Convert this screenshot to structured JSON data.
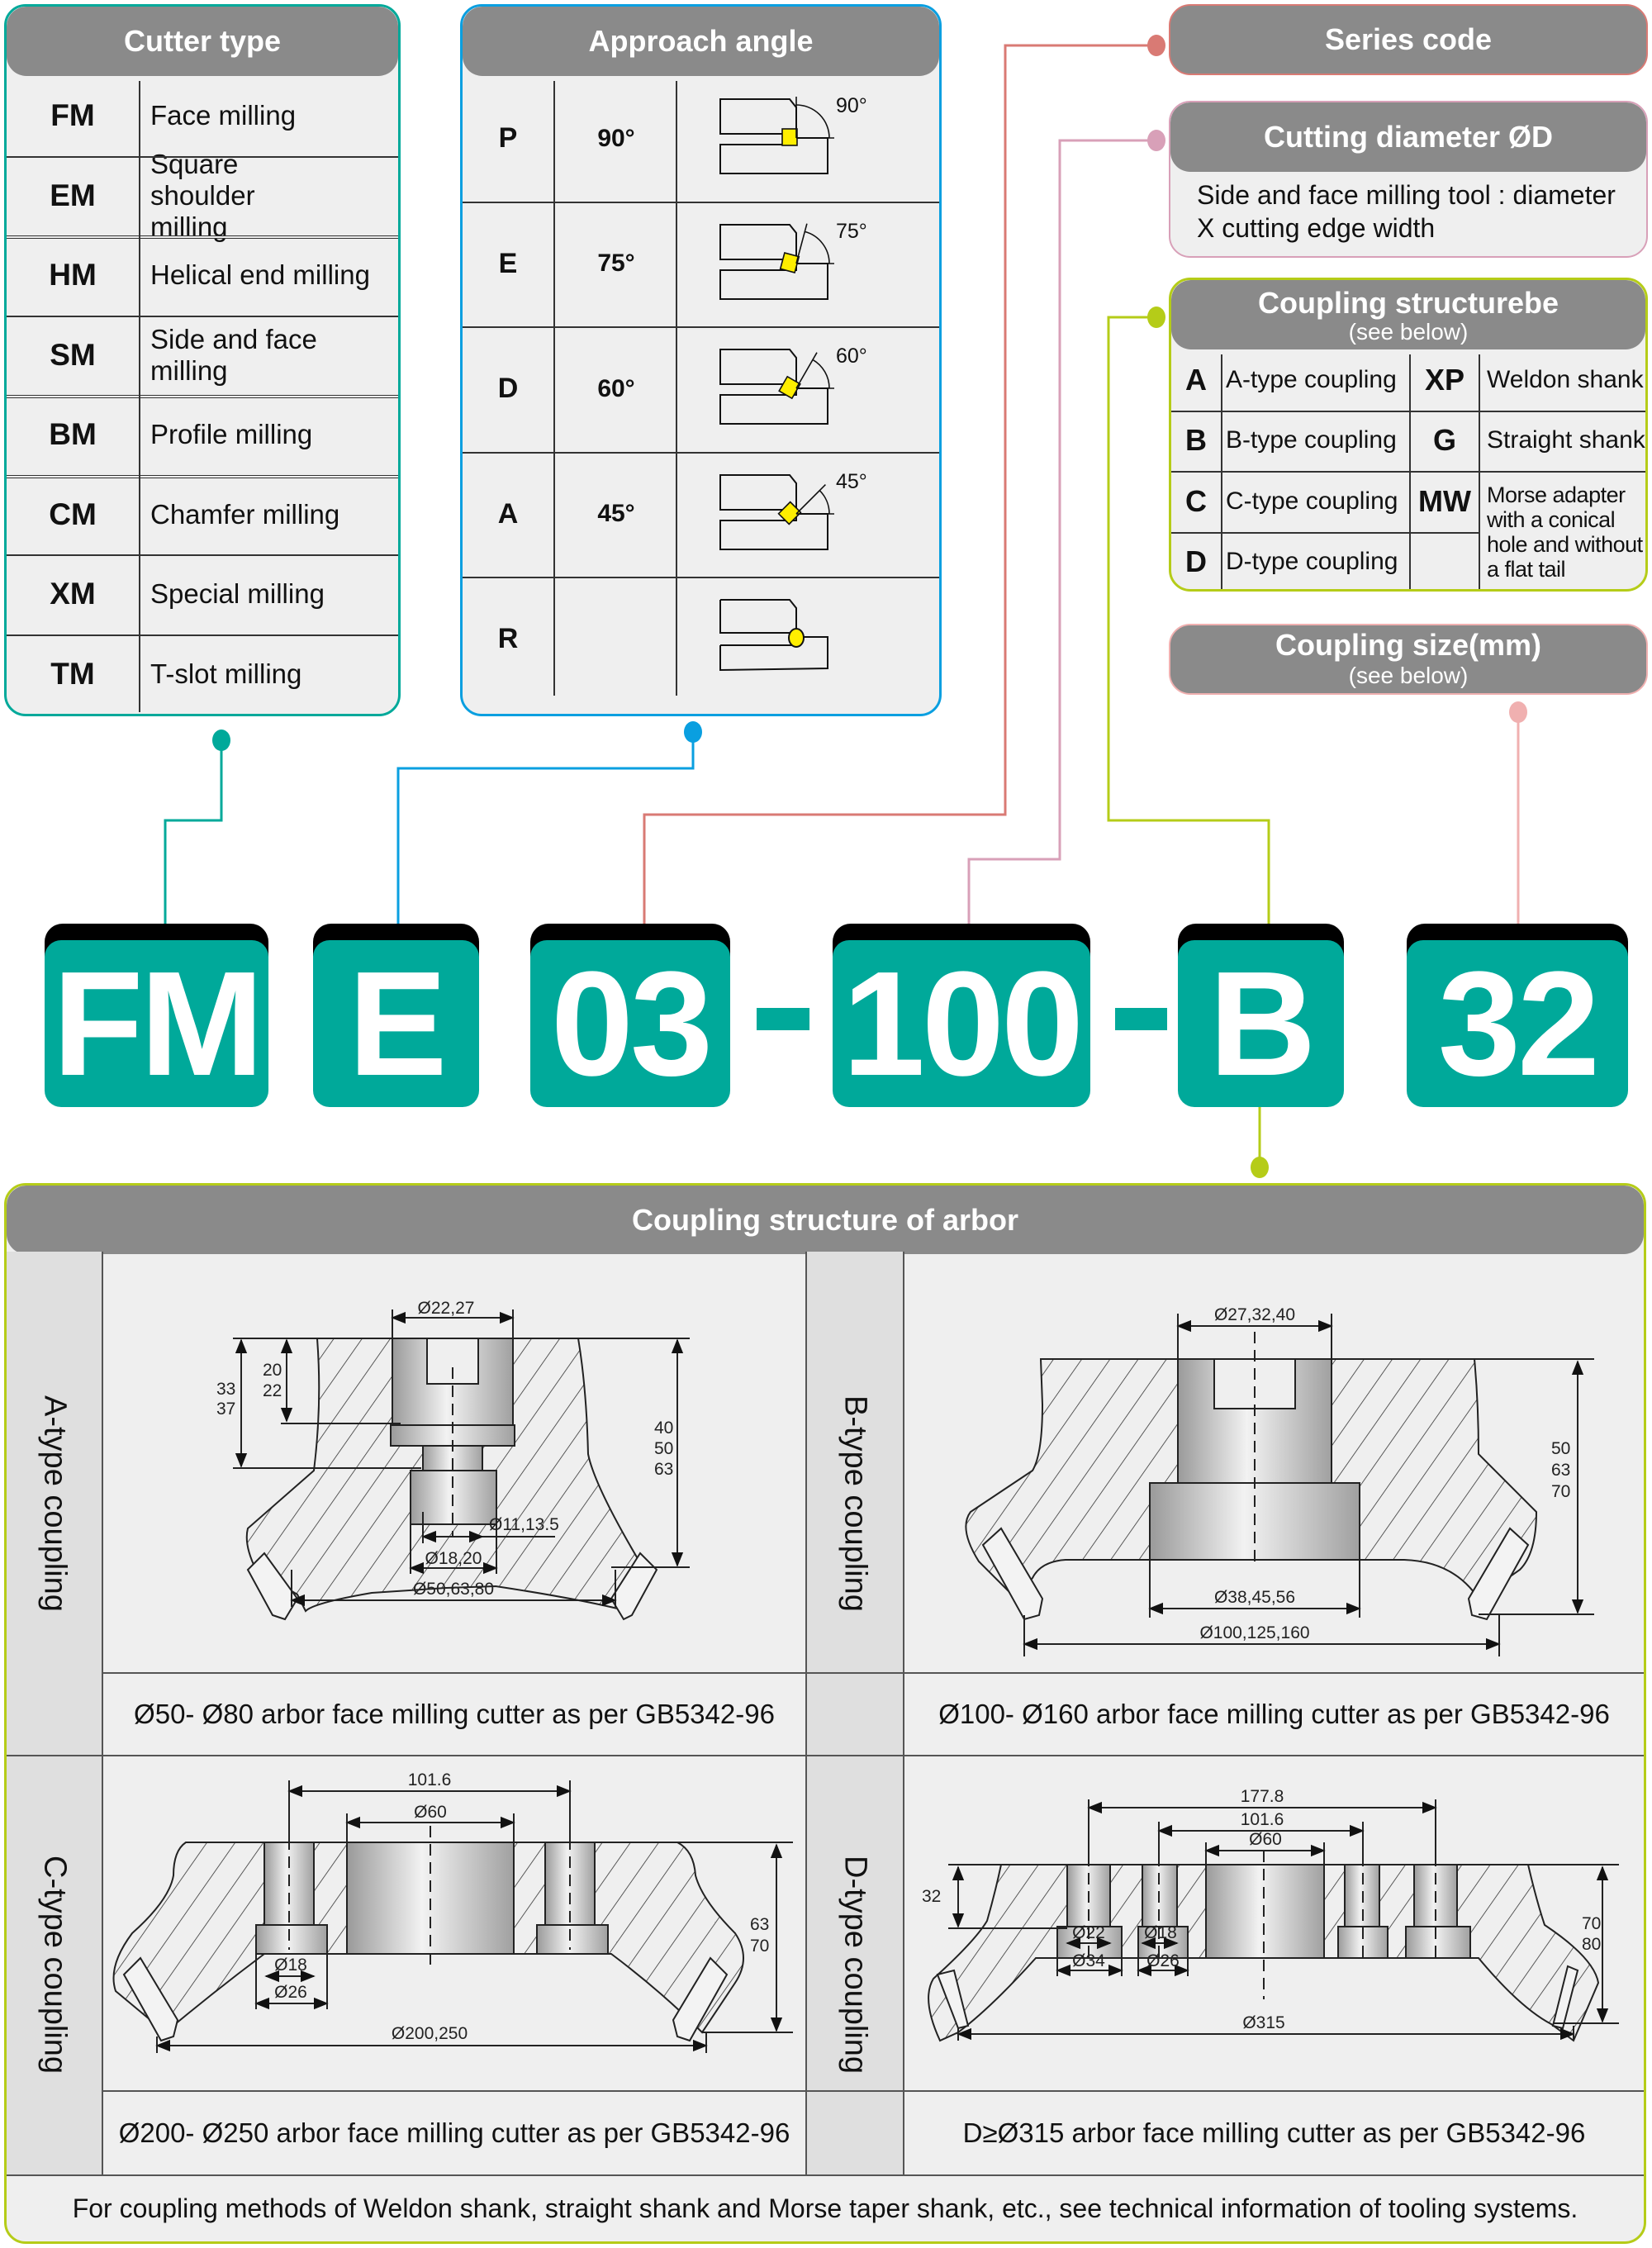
{
  "cutter_type": {
    "title": "Cutter type",
    "rows": [
      {
        "code": "FM",
        "label": "Face milling"
      },
      {
        "code": "EM",
        "label": "Square shoulder milling"
      },
      {
        "code": "HM",
        "label": "Helical end milling"
      },
      {
        "code": "SM",
        "label": "Side and face milling"
      },
      {
        "code": "BM",
        "label": "Profile milling"
      },
      {
        "code": "CM",
        "label": "Chamfer milling"
      },
      {
        "code": "XM",
        "label": "Special milling"
      },
      {
        "code": "TM",
        "label": "T-slot milling"
      }
    ]
  },
  "approach_angle": {
    "title": "Approach angle",
    "rows": [
      {
        "code": "P",
        "angle": "90°",
        "icon_label": "90°",
        "insert": "square"
      },
      {
        "code": "E",
        "angle": "75°",
        "icon_label": "75°",
        "insert": "tilted-square"
      },
      {
        "code": "D",
        "angle": "60°",
        "icon_label": "60°",
        "insert": "tilted-square"
      },
      {
        "code": "A",
        "angle": "45°",
        "icon_label": "45°",
        "insert": "diamond"
      },
      {
        "code": "R",
        "angle": "",
        "icon_label": "",
        "insert": "round"
      }
    ]
  },
  "series_code": {
    "title": "Series code"
  },
  "cutting_diameter": {
    "title": "Cutting diameter ØD",
    "note_line1": "Side and face milling tool : diameter",
    "note_line2": "X cutting edge width"
  },
  "coupling_structure": {
    "title": "Coupling structurebe",
    "subtitle": "(see below)",
    "rows": [
      {
        "code": "A",
        "label": "A-type coupling",
        "code2": "XP",
        "label2": "Weldon shank"
      },
      {
        "code": "B",
        "label": "B-type coupling",
        "code2": "G",
        "label2": "Straight shank"
      },
      {
        "code": "C",
        "label": "C-type coupling",
        "code2": "MW",
        "label2": "Morse adapter with a conical hole and without a flat tail"
      },
      {
        "code": "D",
        "label": "D-type coupling",
        "code2": "",
        "label2": ""
      }
    ]
  },
  "coupling_size": {
    "title": "Coupling size(mm)",
    "subtitle": "(see below)"
  },
  "designation": {
    "parts": [
      "FM",
      "E",
      "03",
      "100",
      "B",
      "32"
    ],
    "separator": "-"
  },
  "colors": {
    "teal": "#00a99a",
    "blue": "#0a9fe0",
    "red": "#d97a74",
    "pink": "#d8a0b8",
    "lime": "#b5cc18",
    "salmon": "#f0b0b0",
    "header_gray": "#8a8a8a",
    "insert_yellow": "#ffee00"
  },
  "arbor": {
    "title": "Coupling structure of arbor",
    "a": {
      "label": "A-type coupling",
      "caption": "Ø50- Ø80 arbor face milling cutter as per GB5342-96",
      "dims": {
        "top": "Ø22,27",
        "h1a": "20",
        "h1b": "22",
        "h2a": "33",
        "h2b": "37",
        "ha": "40",
        "hb": "50",
        "hc": "63",
        "bolt": "Ø11,13.5",
        "bore": "Ø18,20",
        "dia": "Ø50,63,80"
      }
    },
    "b": {
      "label": "B-type coupling",
      "caption": "Ø100- Ø160 arbor face milling cutter as per GB5342-96",
      "dims": {
        "top": "Ø27,32,40",
        "ha": "50",
        "hb": "63",
        "hc": "70",
        "bore": "Ø38,45,56",
        "dia": "Ø100,125,160"
      }
    },
    "c": {
      "label": "C-type coupling",
      "caption": "Ø200- Ø250 arbor face milling cutter as per GB5342-96",
      "dims": {
        "pcd": "101.6",
        "bore": "Ø60",
        "ha": "63",
        "hb": "70",
        "h1": "Ø18",
        "h2": "Ø26",
        "dia": "Ø200,250"
      }
    },
    "d": {
      "label": "D-type coupling",
      "caption": "D≥Ø315 arbor face milling cutter as per GB5342-96",
      "dims": {
        "pcd1": "177.8",
        "pcd2": "101.6",
        "bore": "Ø60",
        "depth": "32",
        "ha": "70",
        "hb": "80",
        "h1": "Ø22",
        "h2": "Ø34",
        "h3": "Ø18",
        "h4": "Ø26",
        "dia": "Ø315"
      }
    },
    "footer": "For coupling methods of Weldon shank, straight shank and Morse taper shank, etc., see technical information of tooling systems."
  }
}
